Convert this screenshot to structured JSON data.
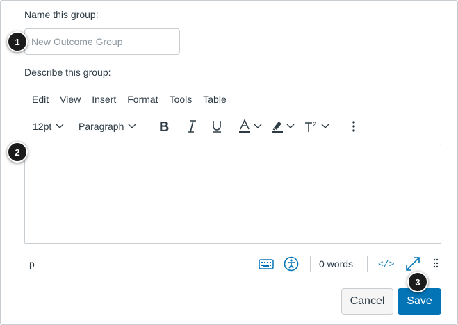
{
  "form": {
    "name_label": "Name this group:",
    "name_placeholder": "New Outcome Group",
    "name_value": "",
    "describe_label": "Describe this group:"
  },
  "editor": {
    "menu": [
      "Edit",
      "View",
      "Insert",
      "Format",
      "Tools",
      "Table"
    ],
    "toolbar": {
      "font_size": "12pt",
      "block_format": "Paragraph",
      "bold_icon": "bold-icon",
      "italic_icon": "italic-icon",
      "underline_icon": "underline-icon",
      "text_color_icon": "text-color-icon",
      "highlight_icon": "highlight-icon",
      "superscript_icon": "superscript-icon",
      "more_icon": "more-vertical-icon"
    },
    "content": "",
    "status": {
      "element_path": "p",
      "word_count": "0 words",
      "keyboard_icon": "keyboard-icon",
      "accessibility_icon": "accessibility-icon",
      "html_editor_label": "</>",
      "fullscreen_icon": "fullscreen-icon",
      "resize_icon": "drag-handle-icon"
    }
  },
  "actions": {
    "cancel_label": "Cancel",
    "save_label": "Save"
  },
  "callouts": [
    "1",
    "2",
    "3"
  ],
  "colors": {
    "primary": "#0374b5",
    "text": "#2d3b45",
    "border": "#c7cdd1",
    "callout": "#1b1b1b"
  }
}
